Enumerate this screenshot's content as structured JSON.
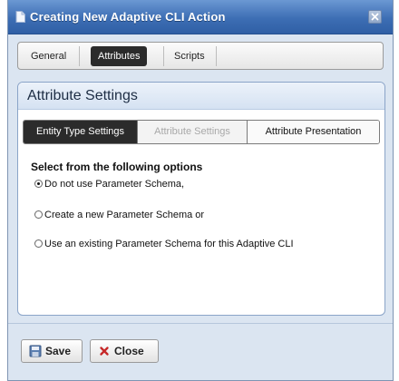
{
  "window": {
    "title": "Creating New Adaptive CLI Action"
  },
  "tabs": [
    {
      "label": "General",
      "active": false
    },
    {
      "label": "Attributes",
      "active": true
    },
    {
      "label": "Scripts",
      "active": false
    }
  ],
  "panel": {
    "title": "Attribute Settings"
  },
  "subtabs": [
    {
      "label": "Entity Type Settings",
      "state": "active"
    },
    {
      "label": "Attribute Settings",
      "state": "disabled"
    },
    {
      "label": "Attribute Presentation",
      "state": "normal"
    }
  ],
  "options": {
    "heading": "Select from the following options",
    "items": [
      {
        "label": "Do not use Parameter Schema,",
        "selected": true
      },
      {
        "label": "Create a new Parameter Schema or",
        "selected": false
      },
      {
        "label": "Use an existing Parameter Schema for this Adaptive CLI",
        "selected": false
      }
    ]
  },
  "buttons": {
    "save": "Save",
    "close": "Close"
  },
  "icons": {
    "title": "document-icon",
    "close": "close-window-icon",
    "save": "save-icon",
    "cancel": "x-icon"
  },
  "colors": {
    "title_bar": "#3d6eb4",
    "active_tab": "#2b2b2b",
    "dialog_bg": "#dbe5f1",
    "close_x": "#c62828"
  }
}
